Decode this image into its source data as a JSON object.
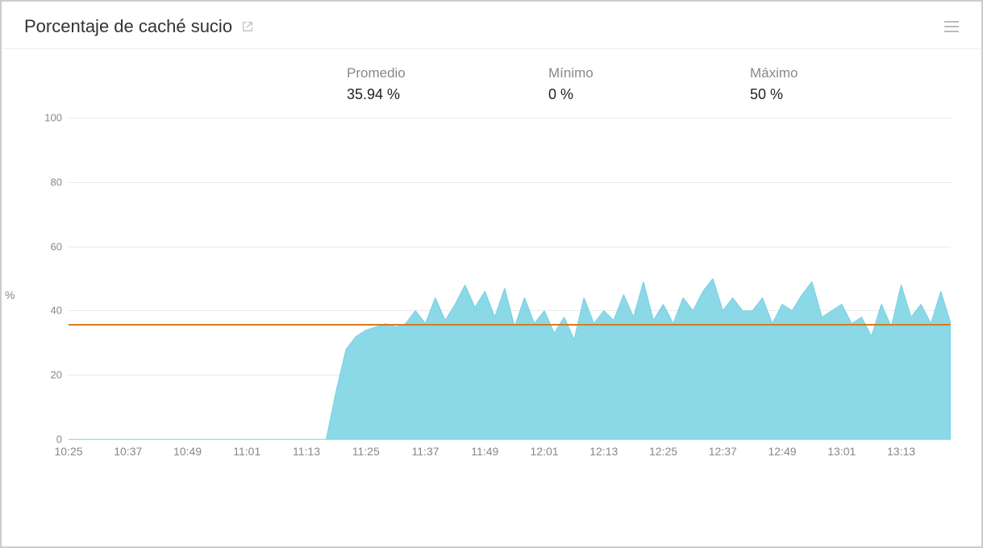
{
  "header": {
    "title": "Porcentaje de caché sucio"
  },
  "stats": {
    "avg_label": "Promedio",
    "avg_value": "35.94 %",
    "min_label": "Mínimo",
    "min_value": "0 %",
    "max_label": "Máximo",
    "max_value": "50 %"
  },
  "chart_data": {
    "type": "area",
    "ylabel": "%",
    "ylim": [
      0,
      100
    ],
    "y_ticks": [
      0,
      20,
      40,
      60,
      80,
      100
    ],
    "x_ticks": [
      "10:25",
      "10:37",
      "10:49",
      "11:01",
      "11:13",
      "11:25",
      "11:37",
      "11:49",
      "12:01",
      "12:13",
      "12:25",
      "12:37",
      "12:49",
      "13:01",
      "13:13"
    ],
    "xrange_minutes": [
      625,
      803
    ],
    "average_line": 35.94,
    "series": [
      {
        "name": "Porcentaje de caché sucio",
        "color": "#77d1e3",
        "data": [
          {
            "t": "10:25",
            "v": 0
          },
          {
            "t": "10:37",
            "v": 0
          },
          {
            "t": "10:49",
            "v": 0
          },
          {
            "t": "11:01",
            "v": 0
          },
          {
            "t": "11:13",
            "v": 0
          },
          {
            "t": "11:17",
            "v": 0
          },
          {
            "t": "11:19",
            "v": 15
          },
          {
            "t": "11:21",
            "v": 28
          },
          {
            "t": "11:23",
            "v": 32
          },
          {
            "t": "11:25",
            "v": 34
          },
          {
            "t": "11:27",
            "v": 35
          },
          {
            "t": "11:29",
            "v": 36
          },
          {
            "t": "11:31",
            "v": 35
          },
          {
            "t": "11:33",
            "v": 36
          },
          {
            "t": "11:35",
            "v": 40
          },
          {
            "t": "11:37",
            "v": 36
          },
          {
            "t": "11:39",
            "v": 44
          },
          {
            "t": "11:41",
            "v": 37
          },
          {
            "t": "11:43",
            "v": 42
          },
          {
            "t": "11:45",
            "v": 48
          },
          {
            "t": "11:47",
            "v": 41
          },
          {
            "t": "11:49",
            "v": 46
          },
          {
            "t": "11:51",
            "v": 38
          },
          {
            "t": "11:53",
            "v": 47
          },
          {
            "t": "11:55",
            "v": 35
          },
          {
            "t": "11:57",
            "v": 44
          },
          {
            "t": "11:59",
            "v": 36
          },
          {
            "t": "12:01",
            "v": 40
          },
          {
            "t": "12:03",
            "v": 33
          },
          {
            "t": "12:05",
            "v": 38
          },
          {
            "t": "12:07",
            "v": 31
          },
          {
            "t": "12:09",
            "v": 44
          },
          {
            "t": "12:11",
            "v": 36
          },
          {
            "t": "12:13",
            "v": 40
          },
          {
            "t": "12:15",
            "v": 37
          },
          {
            "t": "12:17",
            "v": 45
          },
          {
            "t": "12:19",
            "v": 38
          },
          {
            "t": "12:21",
            "v": 49
          },
          {
            "t": "12:23",
            "v": 37
          },
          {
            "t": "12:25",
            "v": 42
          },
          {
            "t": "12:27",
            "v": 36
          },
          {
            "t": "12:29",
            "v": 44
          },
          {
            "t": "12:31",
            "v": 40
          },
          {
            "t": "12:33",
            "v": 46
          },
          {
            "t": "12:35",
            "v": 50
          },
          {
            "t": "12:37",
            "v": 40
          },
          {
            "t": "12:39",
            "v": 44
          },
          {
            "t": "12:41",
            "v": 40
          },
          {
            "t": "12:43",
            "v": 40
          },
          {
            "t": "12:45",
            "v": 44
          },
          {
            "t": "12:47",
            "v": 36
          },
          {
            "t": "12:49",
            "v": 42
          },
          {
            "t": "12:51",
            "v": 40
          },
          {
            "t": "12:53",
            "v": 45
          },
          {
            "t": "12:55",
            "v": 49
          },
          {
            "t": "12:57",
            "v": 38
          },
          {
            "t": "12:59",
            "v": 40
          },
          {
            "t": "13:01",
            "v": 42
          },
          {
            "t": "13:03",
            "v": 36
          },
          {
            "t": "13:05",
            "v": 38
          },
          {
            "t": "13:07",
            "v": 32
          },
          {
            "t": "13:09",
            "v": 42
          },
          {
            "t": "13:11",
            "v": 35
          },
          {
            "t": "13:13",
            "v": 48
          },
          {
            "t": "13:15",
            "v": 38
          },
          {
            "t": "13:17",
            "v": 42
          },
          {
            "t": "13:19",
            "v": 36
          },
          {
            "t": "13:21",
            "v": 46
          },
          {
            "t": "13:23",
            "v": 36
          }
        ]
      }
    ]
  }
}
